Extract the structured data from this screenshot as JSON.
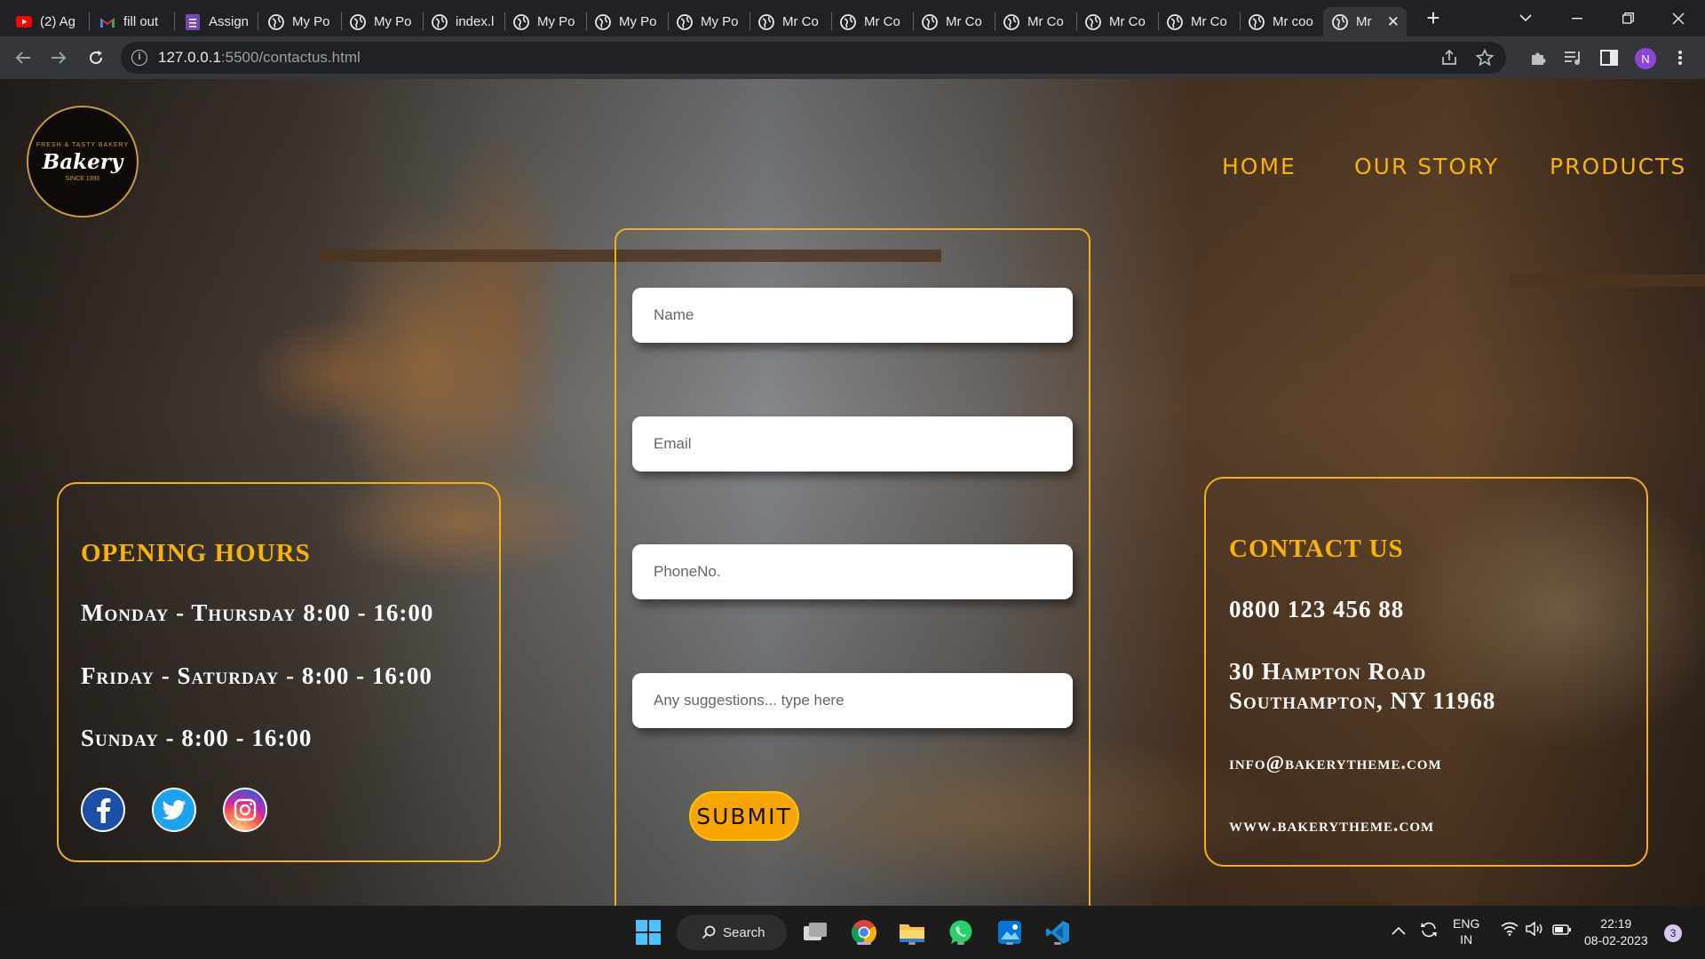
{
  "browser": {
    "tabs": [
      {
        "title": "(2) Ag",
        "icon": "youtube-icon"
      },
      {
        "title": "fill out",
        "icon": "gmail-icon"
      },
      {
        "title": "Assign",
        "icon": "forms-icon"
      },
      {
        "title": "My Po",
        "icon": "globe-icon"
      },
      {
        "title": "My Po",
        "icon": "globe-icon"
      },
      {
        "title": "index.l",
        "icon": "globe-icon"
      },
      {
        "title": "My Po",
        "icon": "globe-icon"
      },
      {
        "title": "My Po",
        "icon": "globe-icon"
      },
      {
        "title": "My Po",
        "icon": "globe-icon"
      },
      {
        "title": "Mr Co",
        "icon": "globe-icon"
      },
      {
        "title": "Mr Co",
        "icon": "globe-icon"
      },
      {
        "title": "Mr Co",
        "icon": "globe-icon"
      },
      {
        "title": "Mr Co",
        "icon": "globe-icon"
      },
      {
        "title": "Mr Co",
        "icon": "globe-icon"
      },
      {
        "title": "Mr Co",
        "icon": "globe-icon"
      },
      {
        "title": "Mr coo",
        "icon": "globe-icon"
      },
      {
        "title": "Mr",
        "icon": "globe-icon",
        "active": true
      }
    ],
    "url_host": "127.0.0.1",
    "url_rest": ":5500/contactus.html",
    "profile_initial": "N"
  },
  "site": {
    "logo": {
      "top": "FRESH & TASTY BAKERY",
      "word": "Bakery",
      "sub": "SINCE 1990"
    },
    "nav": [
      "HOME",
      "OUR STORY",
      "PRODUCTS"
    ],
    "hours": {
      "title": "OPENING HOURS",
      "lines": [
        "Monday - Thursday 8:00 - 16:00",
        "Friday - Saturday - 8:00 - 16:00",
        "Sunday - 8:00 - 16:00"
      ]
    },
    "social": [
      "facebook-icon",
      "twitter-icon",
      "instagram-icon"
    ],
    "form": {
      "name_placeholder": "Name",
      "email_placeholder": "Email",
      "phone_placeholder": "PhoneNo.",
      "suggest_placeholder": "Any suggestions...  type here",
      "submit_label": "SUBMIT"
    },
    "contact": {
      "title": "CONTACT US",
      "phone": "0800 123 456 88",
      "address1": "30 Hampton Road",
      "address2": "Southampton, NY 11968",
      "email": "info@bakerytheme.com",
      "website": "www.bakerytheme.com"
    },
    "colors": {
      "accent": "#f7b500",
      "card_border": "#f2b01e"
    }
  },
  "taskbar": {
    "search_label": "Search",
    "lang1": "ENG",
    "lang2": "IN",
    "time": "22:19",
    "date": "08-02-2023",
    "notification_count": "3"
  }
}
